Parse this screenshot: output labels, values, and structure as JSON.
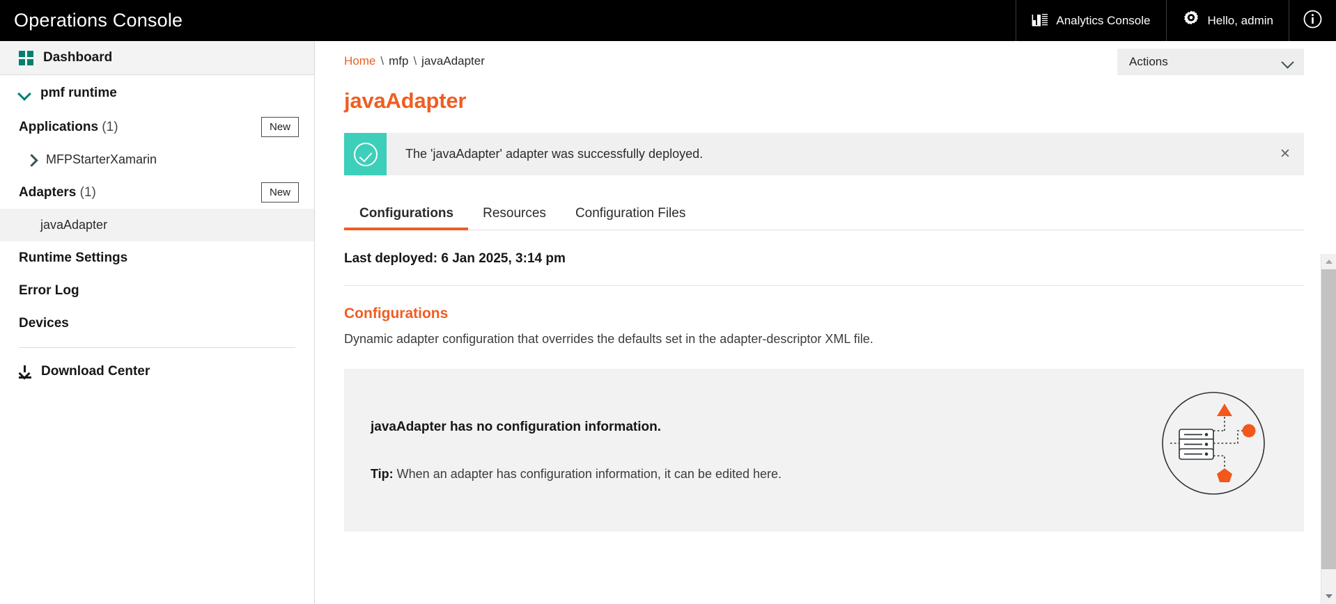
{
  "header": {
    "title": "Operations Console",
    "analytics_label": "Analytics Console",
    "user_label": "Hello, admin",
    "analytics_icon": "bar-chart-icon",
    "user_icon": "gear-icon",
    "info_icon": "info-circle-icon"
  },
  "sidebar": {
    "dashboard_label": "Dashboard",
    "dashboard_icon": "grid-icon",
    "runtime_label": "pmf runtime",
    "runtime_chevron": "chevron-down-icon",
    "applications": {
      "label": "Applications",
      "count": "(1)",
      "new_label": "New",
      "items": [
        {
          "label": "MFPStarterXamarin",
          "chevron": "chevron-right-icon"
        }
      ]
    },
    "adapters": {
      "label": "Adapters",
      "count": "(1)",
      "new_label": "New",
      "items": [
        {
          "label": "javaAdapter",
          "selected": true
        }
      ]
    },
    "nav": [
      {
        "label": "Runtime Settings"
      },
      {
        "label": "Error Log"
      },
      {
        "label": "Devices"
      }
    ],
    "download_center_label": "Download Center",
    "download_icon": "download-icon"
  },
  "breadcrumb": {
    "home": "Home",
    "sep1": "\\",
    "mfp": "mfp",
    "sep2": "\\",
    "current": "javaAdapter"
  },
  "actions": {
    "label": "Actions",
    "chevron": "chevron-down-icon"
  },
  "page": {
    "title": "javaAdapter"
  },
  "banner": {
    "message": "The 'javaAdapter' adapter was successfully deployed.",
    "icon": "check-circle-icon",
    "close_label": "✕",
    "accent_color": "#3dcfba"
  },
  "tabs": [
    {
      "label": "Configurations",
      "active": true
    },
    {
      "label": "Resources",
      "active": false
    },
    {
      "label": "Configuration Files",
      "active": false
    }
  ],
  "content": {
    "last_deployed": "Last deployed: 6 Jan 2025, 3:14 pm",
    "section_title": "Configurations",
    "section_description": "Dynamic adapter configuration that overrides the defaults set in the adapter-descriptor XML file.",
    "empty_heading": "javaAdapter has no configuration information.",
    "empty_tip_label": "Tip:",
    "empty_tip_text": " When an adapter has configuration information, it can be edited here.",
    "empty_illustration": "adapter-network-illustration"
  },
  "scrollbar": {
    "up_icon": "scroll-up-arrow",
    "down_icon": "scroll-down-arrow"
  },
  "colors": {
    "accent_orange": "#f05d22",
    "teal": "#00806e",
    "success_teal": "#3dcfba",
    "header_black": "#000000"
  }
}
